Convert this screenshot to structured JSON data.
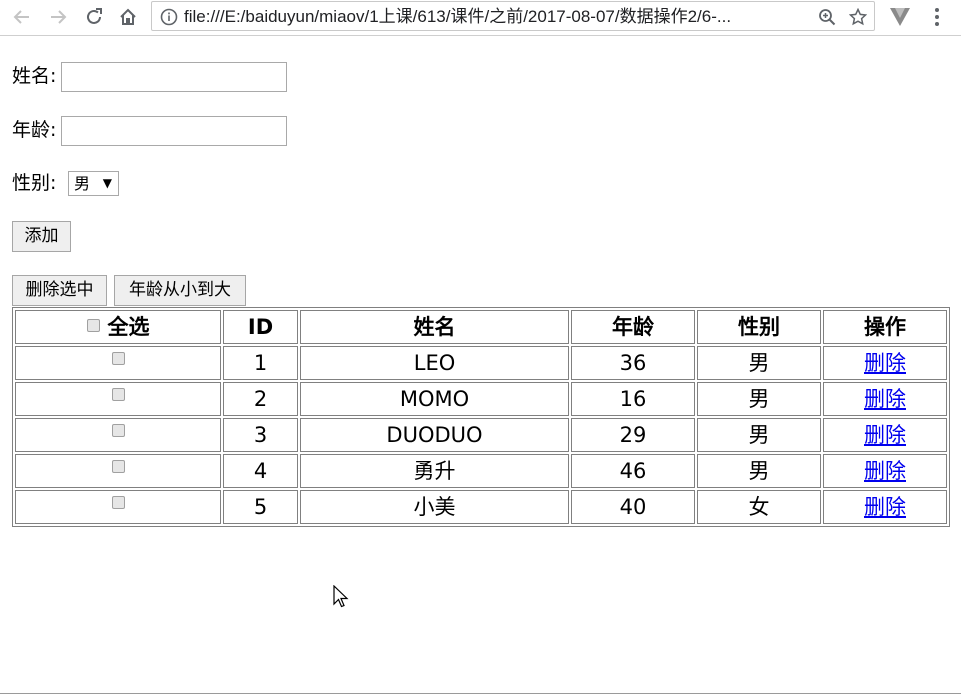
{
  "browser": {
    "url": "file:///E:/baiduyun/miaov/1上课/613/课件/之前/2017-08-07/数据操作2/6-..."
  },
  "form": {
    "name_label": "姓名:",
    "name_value": "",
    "age_label": "年龄:",
    "age_value": "",
    "gender_label": "性别:",
    "gender_selected": "男",
    "add_button": "添加"
  },
  "actions": {
    "delete_selected": "删除选中",
    "sort_age": "年龄从小到大"
  },
  "table": {
    "headers": [
      "全选",
      "ID",
      "姓名",
      "年龄",
      "性别",
      "操作"
    ],
    "rows": [
      {
        "id": "1",
        "name": "LEO",
        "age": "36",
        "gender": "男",
        "action": "删除"
      },
      {
        "id": "2",
        "name": "MOMO",
        "age": "16",
        "gender": "男",
        "action": "删除"
      },
      {
        "id": "3",
        "name": "DUODUO",
        "age": "29",
        "gender": "男",
        "action": "删除"
      },
      {
        "id": "4",
        "name": "勇升",
        "age": "46",
        "gender": "男",
        "action": "删除"
      },
      {
        "id": "5",
        "name": "小美",
        "age": "40",
        "gender": "女",
        "action": "删除"
      }
    ]
  },
  "icons": [
    "back-icon",
    "forward-icon",
    "reload-icon",
    "home-icon",
    "info-icon",
    "zoom-icon",
    "star-icon",
    "extension-icon",
    "menu-icon",
    "mouse-cursor-icon"
  ]
}
